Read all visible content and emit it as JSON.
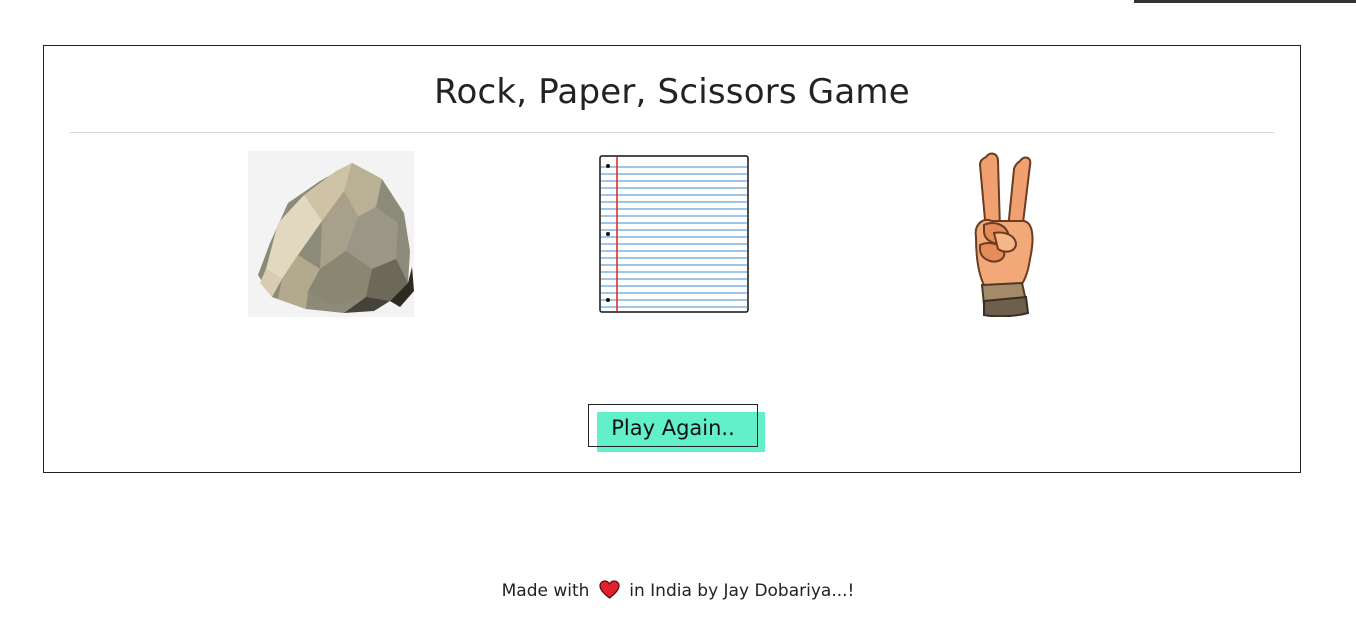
{
  "game": {
    "title": "Rock, Paper, Scissors Game",
    "choices": [
      {
        "name": "rock",
        "icon": "rock-image"
      },
      {
        "name": "paper",
        "icon": "paper-image"
      },
      {
        "name": "scissors",
        "icon": "scissors-hand-image"
      }
    ],
    "play_again_label": "Play Again..",
    "accent_color": "#62f0cb"
  },
  "footer": {
    "text_before": "Made with",
    "icon": "heart-icon",
    "text_after": "in India by Jay Dobariya...!"
  }
}
